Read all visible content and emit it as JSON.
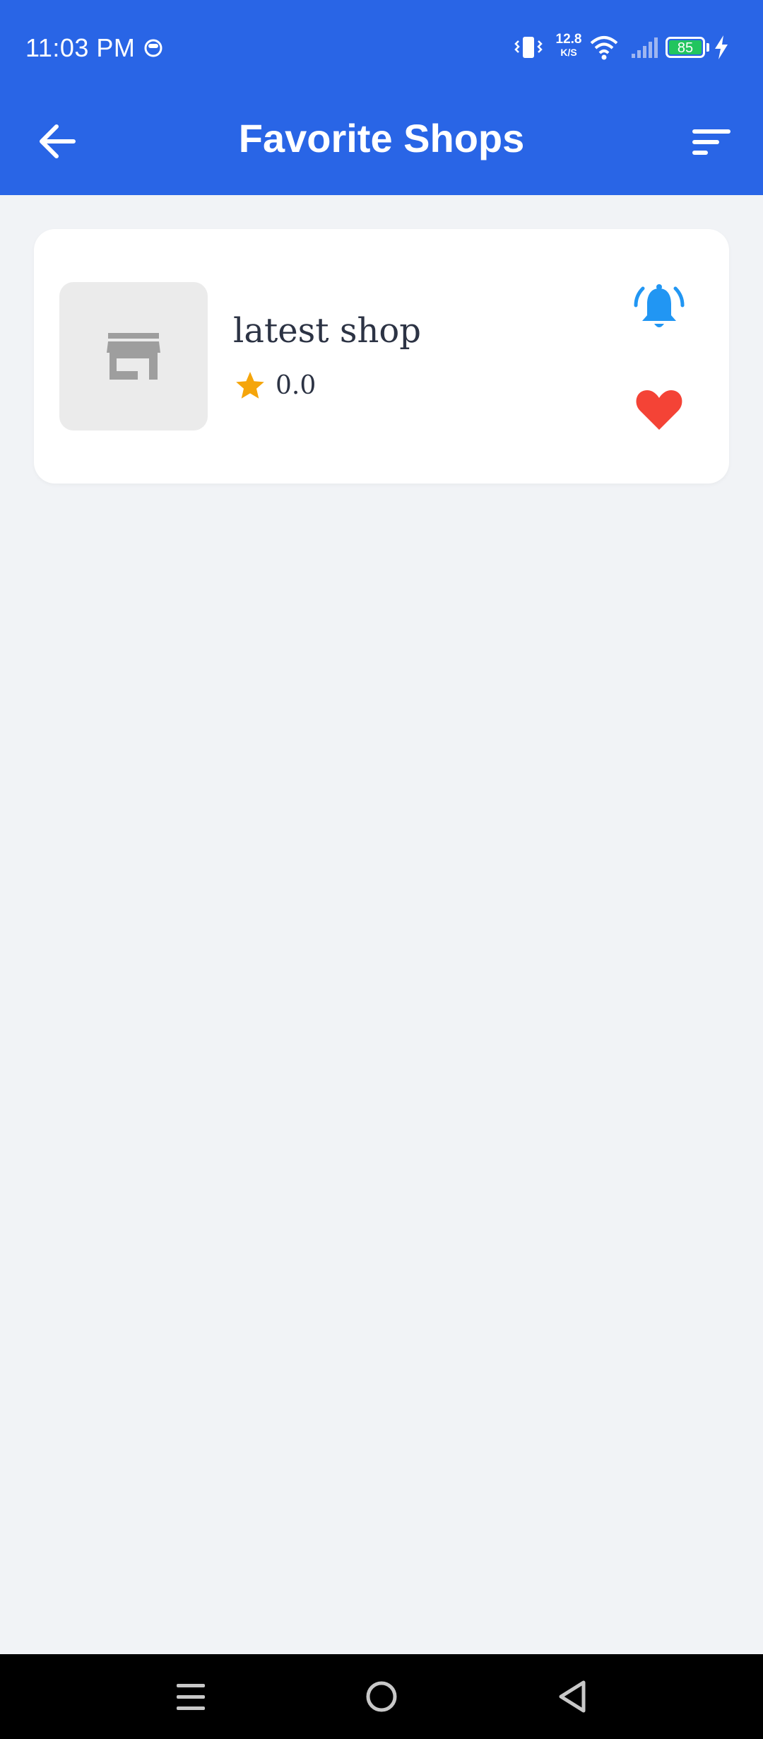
{
  "status_bar": {
    "time": "11:03 PM",
    "net_speed_value": "12.8",
    "net_speed_unit": "K/S",
    "battery": "85",
    "icons": [
      "face-icon",
      "vibrate-icon",
      "wifi-icon",
      "signal-icon",
      "battery-icon",
      "charging-icon"
    ]
  },
  "app_bar": {
    "title": "Favorite Shops",
    "back_icon": "arrow-left-icon",
    "sort_icon": "sort-icon"
  },
  "shops": [
    {
      "name": "latest shop",
      "rating": "0.0",
      "thumbnail_icon": "store-icon",
      "notify_icon": "bell-ringing-icon",
      "favorite_icon": "heart-icon"
    }
  ],
  "colors": {
    "primary": "#2965e6",
    "background": "#f1f3f6",
    "star": "#f5a50b",
    "bell": "#2196f3",
    "heart": "#f44336",
    "battery": "#22c55e"
  },
  "nav_bar": {
    "icons": [
      "menu-icon",
      "home-circle-icon",
      "back-triangle-icon"
    ]
  }
}
